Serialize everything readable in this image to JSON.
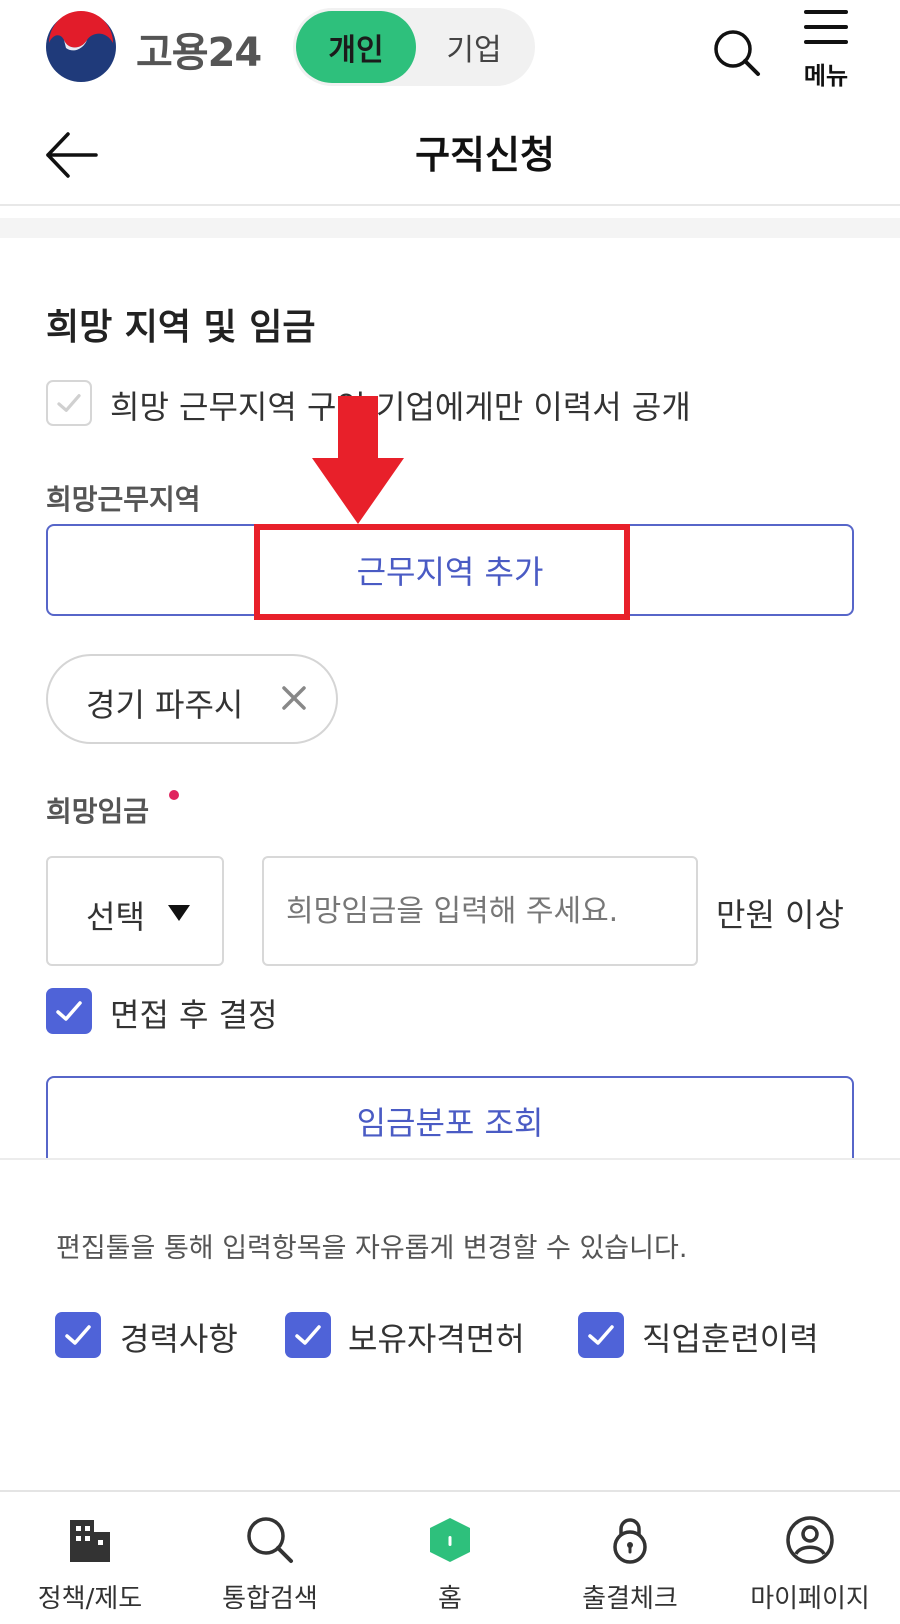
{
  "header": {
    "brand": "고용24",
    "toggle_active": "개인",
    "toggle_inactive": "기업",
    "menu_label": "메뉴"
  },
  "page": {
    "title": "구직신청"
  },
  "section": {
    "title": "희망 지역 및 임금",
    "region_only_checkbox": {
      "label": "희망 근무지역 구인 기업에게만 이력서 공개",
      "checked": true,
      "disabled": true
    },
    "region_label": "희망근무지역",
    "add_region_button": "근무지역 추가",
    "region_chip": "경기 파주시",
    "wage_label": "희망임금",
    "wage_select": "선택",
    "wage_input_placeholder": "희망임금을 입력해 주세요.",
    "wage_unit": "만원 이상",
    "after_interview_checkbox": {
      "label": "면접 후 결정",
      "checked": true
    },
    "wage_distribution_button": "임금분포 조회"
  },
  "editor": {
    "note": "편집툴을 통해 입력항목을 자유롭게 변경할 수 있습니다.",
    "options": [
      {
        "label": "경력사항",
        "checked": true
      },
      {
        "label": "보유자격면허",
        "checked": true
      },
      {
        "label": "직업훈련이력",
        "checked": true
      }
    ]
  },
  "bottom_nav": [
    {
      "label": "정책/제도",
      "icon": "building-icon"
    },
    {
      "label": "통합검색",
      "icon": "search-icon"
    },
    {
      "label": "홈",
      "icon": "home-icon"
    },
    {
      "label": "출결체크",
      "icon": "lock-icon"
    },
    {
      "label": "마이페이지",
      "icon": "user-icon"
    }
  ],
  "colors": {
    "accent_green": "#2ec07c",
    "accent_blue": "#4f63d8",
    "highlight_red": "#e8202a",
    "required_dot": "#e0245e"
  }
}
